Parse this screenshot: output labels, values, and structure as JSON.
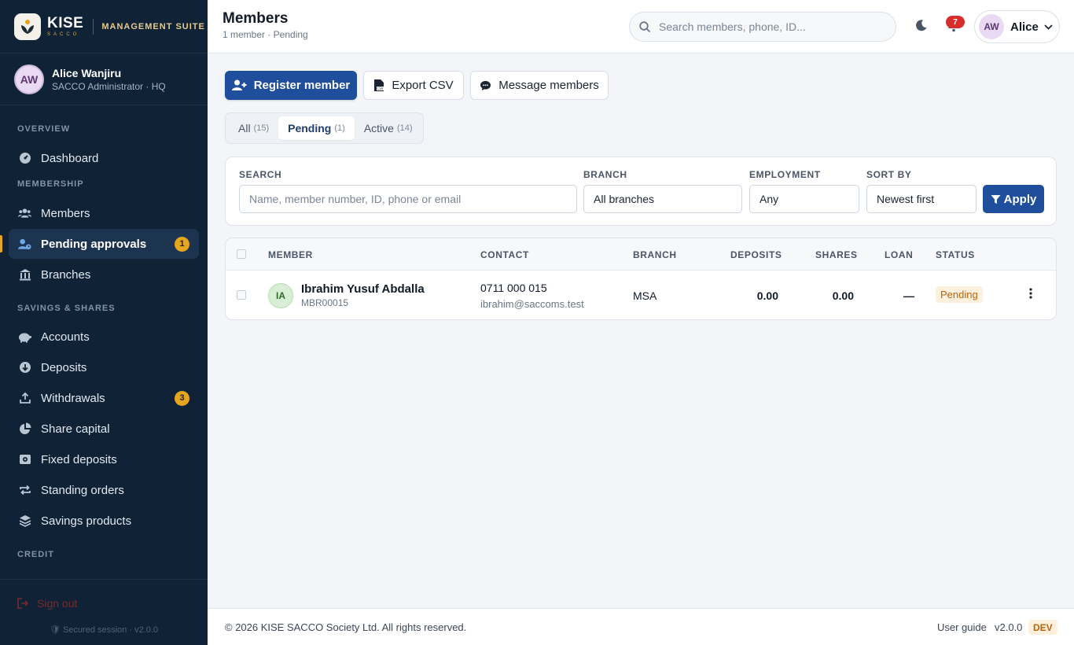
{
  "brand": {
    "name": "KISE",
    "sub": "SACCO",
    "suite": "MANAGEMENT SUITE"
  },
  "user": {
    "initials": "AW",
    "name": "Alice Wanjiru",
    "role": "SACCO Administrator · HQ",
    "short_name": "Alice"
  },
  "nav": {
    "sections": {
      "overview": "OVERVIEW",
      "membership": "MEMBERSHIP",
      "savings": "SAVINGS & SHARES",
      "credit": "CREDIT"
    },
    "items": {
      "dashboard": "Dashboard",
      "members": "Members",
      "pending": "Pending approvals",
      "pending_badge": "1",
      "branches": "Branches",
      "accounts": "Accounts",
      "deposits": "Deposits",
      "withdrawals": "Withdrawals",
      "withdrawals_badge": "3",
      "share_capital": "Share capital",
      "fixed_deposits": "Fixed deposits",
      "standing_orders": "Standing orders",
      "savings_products": "Savings products"
    },
    "signout": "Sign out",
    "secure": "Secured session · v2.0.0"
  },
  "header": {
    "title": "Members",
    "subtitle": "1 member · Pending",
    "search_placeholder": "Search members, phone, ID...",
    "notifications": "7"
  },
  "actions": {
    "register": "Register member",
    "export": "Export CSV",
    "message": "Message members"
  },
  "tabs": [
    {
      "label": "All",
      "count": "(15)"
    },
    {
      "label": "Pending",
      "count": "(1)"
    },
    {
      "label": "Active",
      "count": "(14)"
    }
  ],
  "filters": {
    "search_label": "SEARCH",
    "search_placeholder": "Name, member number, ID, phone or email",
    "branch_label": "BRANCH",
    "branch_value": "All branches",
    "employment_label": "EMPLOYMENT",
    "employment_value": "Any",
    "sort_label": "SORT BY",
    "sort_value": "Newest first",
    "apply": "Apply"
  },
  "table": {
    "headers": {
      "member": "MEMBER",
      "contact": "CONTACT",
      "branch": "BRANCH",
      "deposits": "DEPOSITS",
      "shares": "SHARES",
      "loan": "LOAN",
      "status": "STATUS"
    },
    "rows": [
      {
        "initials": "IA",
        "name": "Ibrahim Yusuf Abdalla",
        "number": "MBR00015",
        "phone": "0711 000 015",
        "email": "ibrahim@saccoms.test",
        "branch": "MSA",
        "deposits": "0.00",
        "shares": "0.00",
        "loan": "—",
        "status": "Pending"
      }
    ]
  },
  "footer": {
    "copyright": "© 2026 KISE SACCO Society Ltd. All rights reserved.",
    "guide": "User guide",
    "version": "v2.0.0",
    "env": "DEV"
  }
}
